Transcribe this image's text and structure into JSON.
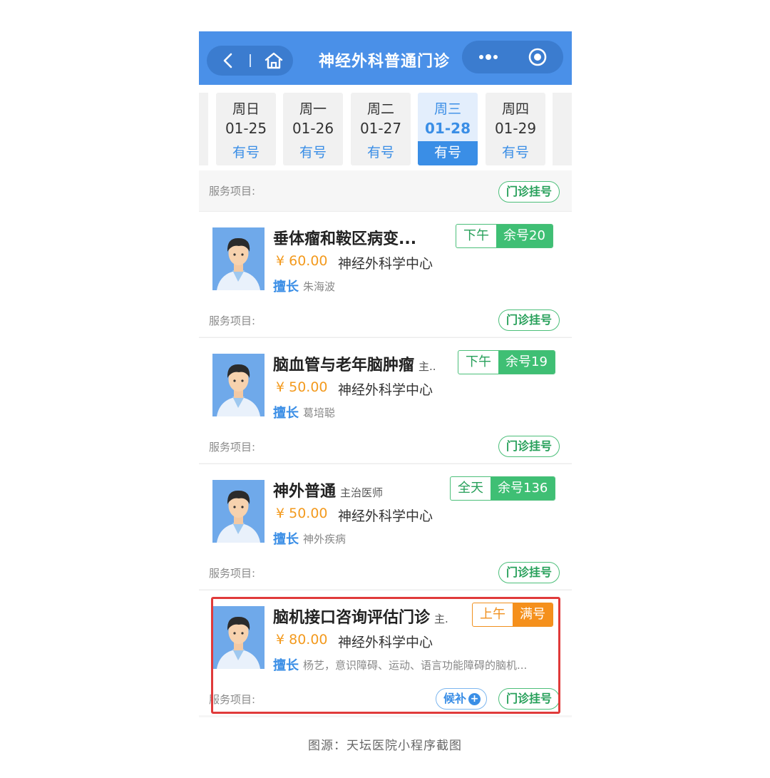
{
  "header": {
    "title": "神经外科普通门诊",
    "color": "#4a90e8"
  },
  "dates": [
    {
      "weekday": "周日",
      "date": "01-25",
      "status": "有号"
    },
    {
      "weekday": "周一",
      "date": "01-26",
      "status": "有号"
    },
    {
      "weekday": "周二",
      "date": "01-27",
      "status": "有号"
    },
    {
      "weekday": "周三",
      "date": "01-28",
      "status": "有号",
      "selected": true
    },
    {
      "weekday": "周四",
      "date": "01-29",
      "status": "有号"
    }
  ],
  "top_service": {
    "label": "服务项目:",
    "button": "门诊挂号"
  },
  "doctors": [
    {
      "title": "垂体瘤和鞍区病变...",
      "role": "",
      "price": "¥ 60.00",
      "dept": "神经外科学中心",
      "spec_label": "擅长",
      "spec_text": "朱海波",
      "period": "下午",
      "remaining": "余号20",
      "service_label": "服务项目:",
      "service_button": "门诊挂号"
    },
    {
      "title": "脑血管与老年脑肿瘤",
      "role": "主..",
      "price": "¥ 50.00",
      "dept": "神经外科学中心",
      "spec_label": "擅长",
      "spec_text": "葛培聪",
      "period": "下午",
      "remaining": "余号19",
      "service_label": "服务项目:",
      "service_button": "门诊挂号"
    },
    {
      "title": "神外普通",
      "role": "主治医师",
      "price": "¥ 50.00",
      "dept": "神经外科学中心",
      "spec_label": "擅长",
      "spec_text": "神外疾病",
      "period": "全天",
      "remaining": "余号136",
      "service_label": "服务项目:",
      "service_button": "门诊挂号"
    },
    {
      "title": "脑机接口咨询评估门诊",
      "role": "主.",
      "price": "¥ 80.00",
      "dept": "神经外科学中心",
      "spec_label": "擅长",
      "spec_text": "杨艺，意识障碍、运动、语言功能障碍的脑机...",
      "period": "上午",
      "remaining": "满号",
      "service_label": "服务项目:",
      "waitlist_button": "候补",
      "service_button": "门诊挂号"
    }
  ],
  "caption": "图源：天坛医院小程序截图"
}
